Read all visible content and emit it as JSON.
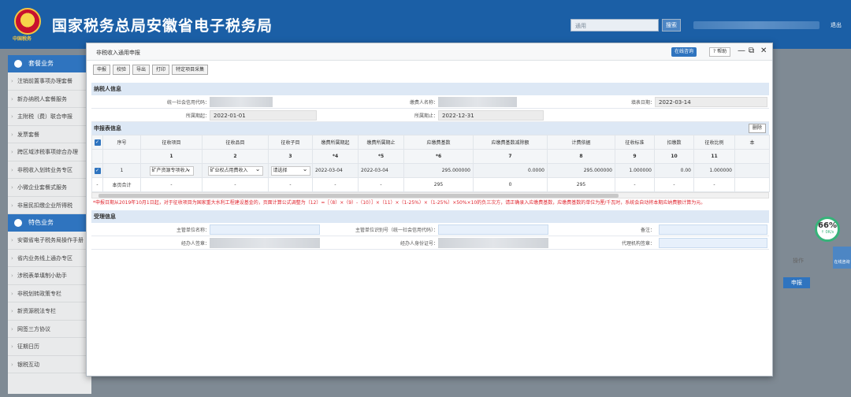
{
  "header": {
    "emblem_caption": "中国税务",
    "site_title": "国家税务总局安徽省电子税务局",
    "search_placeholder": "通用",
    "search_btn": "搜索",
    "logout": "退出"
  },
  "sidebar": {
    "section1": "套餐业务",
    "items1": [
      "注销前置事项办理套餐",
      "新办纳税人套餐服务",
      "主附税（费）联合申报",
      "发票套餐",
      "跨区域涉税事项综合办理",
      "非税收入划转业务专区",
      "小微企业套餐式服务",
      "非居民扣缴企业所得税"
    ],
    "section2": "特色业务",
    "items2": [
      "安徽省电子税务局操作手册",
      "省内业务线上通办专区",
      "涉税表单填制小助手",
      "非税划转政策专栏",
      "新资源税法专栏",
      "网签三方协议",
      "征期日历",
      "银税互动"
    ]
  },
  "right_bg": {
    "operation": "操作",
    "declare": "申报"
  },
  "progress": {
    "pct": "66%",
    "speed": "↑ 0K/s"
  },
  "online_side": "在线咨询",
  "dialog": {
    "title": "非税收入通用申报",
    "online_btn": "在线咨询",
    "help": "帮助",
    "toolbar": [
      "申报",
      "校验",
      "导出",
      "打印",
      "特定项目采集"
    ],
    "taxpayer": {
      "head": "纳税人信息",
      "credit_code_label": "统一社会信用代码：",
      "payer_name_label": "缴费人名称：",
      "fill_date_label": "填表日期：",
      "fill_date": "2022-03-14",
      "period_start_label": "所属期起：",
      "period_start": "2022-01-01",
      "period_end_label": "所属期止：",
      "period_end": "2022-12-31"
    },
    "declare": {
      "head": "申报表信息",
      "delete_btn": "删除",
      "columns": [
        "序号",
        "征收项目",
        "征收品目",
        "征收子目",
        "缴费所属期起",
        "缴费所属期止",
        "应缴费基数",
        "应缴费基数减除额",
        "计费依据",
        "征收标准",
        "扣缴数",
        "征收比例",
        "本"
      ],
      "col_nums": [
        "1",
        "2",
        "3",
        "*4",
        "*5",
        "*6",
        "7",
        "8",
        "9",
        "10",
        "11"
      ],
      "row": {
        "seq": "1",
        "item": "矿产资源专项收入",
        "subitem": "矿业权占用费收入",
        "subcat": "请选择",
        "start": "2022-03-04",
        "end": "2022-03-04",
        "base": "295.000000",
        "deduct": "0.0000",
        "basis": "295.000000",
        "standard": "1.000000",
        "withhold": "0.00",
        "ratio": "1.000000"
      },
      "total": {
        "dash1": "-",
        "label": "本页合计",
        "dash": "-",
        "base": "295",
        "deduct": "0",
        "basis": "295"
      },
      "notice": "*申报日期从2019年10月1日起，对于征收项目为国家重大水利工程建设基金的，页面计算公式调整为（12）=［（8）×（9）-（10）］×（11）×（1-25%）×（1-25%）×50%×10的负三次方，请正确录入应缴费基数，应缴费基数的单位为厘/千瓦时，系统会自动将本期应纳费额计算为元。"
    },
    "accept": {
      "head": "受理信息",
      "unit_name_label": "主管单位名称：",
      "unit_code_label": "主管单位识别号（统一社会信用代码）：",
      "remark_label": "备注：",
      "handler_label": "经办人签章：",
      "handler_id_label": "经办人身份证号：",
      "agent_label": "代理机构签章："
    }
  }
}
